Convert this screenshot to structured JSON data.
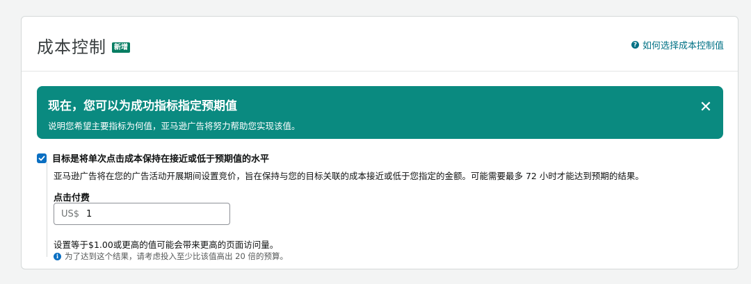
{
  "header": {
    "title": "成本控制",
    "badge": "新增",
    "help_link": "如何选择成本控制值"
  },
  "banner": {
    "title": "现在，您可以为成功指标指定预期值",
    "subtitle": "说明您希望主要指标为何值，亚马逊广告将努力帮助您实现该值。"
  },
  "target": {
    "checked": true,
    "label": "目标是将单次点击成本保持在接近或低于预期值的水平",
    "description": "亚马逊广告将在您的广告活动开展期间设置竞价，旨在保持与您的目标关联的成本接近或低于您指定的金额。可能需要最多 72 小时才能达到预期的结果。",
    "field_label": "点击付费",
    "currency": "US$",
    "value": "1",
    "hint": "设置等于$1.00或更高的值可能会带来更高的页面访问量。",
    "info": "为了达到这个结果，请考虑投入至少比该值高出 20 倍的预算。"
  },
  "colors": {
    "banner_bg": "#0a8a80",
    "badge_bg": "#067d62",
    "link": "#007185",
    "checkbox": "#0a6fc2"
  }
}
